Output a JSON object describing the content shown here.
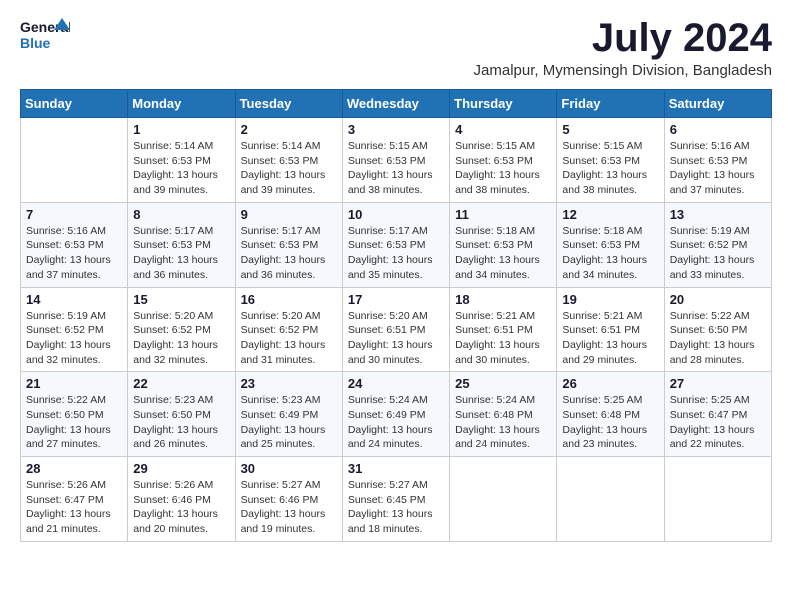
{
  "logo": {
    "line1": "General",
    "line2": "Blue"
  },
  "title": "July 2024",
  "subtitle": "Jamalpur, Mymensingh Division, Bangladesh",
  "header_color": "#2171b5",
  "days_of_week": [
    "Sunday",
    "Monday",
    "Tuesday",
    "Wednesday",
    "Thursday",
    "Friday",
    "Saturday"
  ],
  "weeks": [
    [
      {
        "num": "",
        "info": ""
      },
      {
        "num": "1",
        "info": "Sunrise: 5:14 AM\nSunset: 6:53 PM\nDaylight: 13 hours\nand 39 minutes."
      },
      {
        "num": "2",
        "info": "Sunrise: 5:14 AM\nSunset: 6:53 PM\nDaylight: 13 hours\nand 39 minutes."
      },
      {
        "num": "3",
        "info": "Sunrise: 5:15 AM\nSunset: 6:53 PM\nDaylight: 13 hours\nand 38 minutes."
      },
      {
        "num": "4",
        "info": "Sunrise: 5:15 AM\nSunset: 6:53 PM\nDaylight: 13 hours\nand 38 minutes."
      },
      {
        "num": "5",
        "info": "Sunrise: 5:15 AM\nSunset: 6:53 PM\nDaylight: 13 hours\nand 38 minutes."
      },
      {
        "num": "6",
        "info": "Sunrise: 5:16 AM\nSunset: 6:53 PM\nDaylight: 13 hours\nand 37 minutes."
      }
    ],
    [
      {
        "num": "7",
        "info": "Sunrise: 5:16 AM\nSunset: 6:53 PM\nDaylight: 13 hours\nand 37 minutes."
      },
      {
        "num": "8",
        "info": "Sunrise: 5:17 AM\nSunset: 6:53 PM\nDaylight: 13 hours\nand 36 minutes."
      },
      {
        "num": "9",
        "info": "Sunrise: 5:17 AM\nSunset: 6:53 PM\nDaylight: 13 hours\nand 36 minutes."
      },
      {
        "num": "10",
        "info": "Sunrise: 5:17 AM\nSunset: 6:53 PM\nDaylight: 13 hours\nand 35 minutes."
      },
      {
        "num": "11",
        "info": "Sunrise: 5:18 AM\nSunset: 6:53 PM\nDaylight: 13 hours\nand 34 minutes."
      },
      {
        "num": "12",
        "info": "Sunrise: 5:18 AM\nSunset: 6:53 PM\nDaylight: 13 hours\nand 34 minutes."
      },
      {
        "num": "13",
        "info": "Sunrise: 5:19 AM\nSunset: 6:52 PM\nDaylight: 13 hours\nand 33 minutes."
      }
    ],
    [
      {
        "num": "14",
        "info": "Sunrise: 5:19 AM\nSunset: 6:52 PM\nDaylight: 13 hours\nand 32 minutes."
      },
      {
        "num": "15",
        "info": "Sunrise: 5:20 AM\nSunset: 6:52 PM\nDaylight: 13 hours\nand 32 minutes."
      },
      {
        "num": "16",
        "info": "Sunrise: 5:20 AM\nSunset: 6:52 PM\nDaylight: 13 hours\nand 31 minutes."
      },
      {
        "num": "17",
        "info": "Sunrise: 5:20 AM\nSunset: 6:51 PM\nDaylight: 13 hours\nand 30 minutes."
      },
      {
        "num": "18",
        "info": "Sunrise: 5:21 AM\nSunset: 6:51 PM\nDaylight: 13 hours\nand 30 minutes."
      },
      {
        "num": "19",
        "info": "Sunrise: 5:21 AM\nSunset: 6:51 PM\nDaylight: 13 hours\nand 29 minutes."
      },
      {
        "num": "20",
        "info": "Sunrise: 5:22 AM\nSunset: 6:50 PM\nDaylight: 13 hours\nand 28 minutes."
      }
    ],
    [
      {
        "num": "21",
        "info": "Sunrise: 5:22 AM\nSunset: 6:50 PM\nDaylight: 13 hours\nand 27 minutes."
      },
      {
        "num": "22",
        "info": "Sunrise: 5:23 AM\nSunset: 6:50 PM\nDaylight: 13 hours\nand 26 minutes."
      },
      {
        "num": "23",
        "info": "Sunrise: 5:23 AM\nSunset: 6:49 PM\nDaylight: 13 hours\nand 25 minutes."
      },
      {
        "num": "24",
        "info": "Sunrise: 5:24 AM\nSunset: 6:49 PM\nDaylight: 13 hours\nand 24 minutes."
      },
      {
        "num": "25",
        "info": "Sunrise: 5:24 AM\nSunset: 6:48 PM\nDaylight: 13 hours\nand 24 minutes."
      },
      {
        "num": "26",
        "info": "Sunrise: 5:25 AM\nSunset: 6:48 PM\nDaylight: 13 hours\nand 23 minutes."
      },
      {
        "num": "27",
        "info": "Sunrise: 5:25 AM\nSunset: 6:47 PM\nDaylight: 13 hours\nand 22 minutes."
      }
    ],
    [
      {
        "num": "28",
        "info": "Sunrise: 5:26 AM\nSunset: 6:47 PM\nDaylight: 13 hours\nand 21 minutes."
      },
      {
        "num": "29",
        "info": "Sunrise: 5:26 AM\nSunset: 6:46 PM\nDaylight: 13 hours\nand 20 minutes."
      },
      {
        "num": "30",
        "info": "Sunrise: 5:27 AM\nSunset: 6:46 PM\nDaylight: 13 hours\nand 19 minutes."
      },
      {
        "num": "31",
        "info": "Sunrise: 5:27 AM\nSunset: 6:45 PM\nDaylight: 13 hours\nand 18 minutes."
      },
      {
        "num": "",
        "info": ""
      },
      {
        "num": "",
        "info": ""
      },
      {
        "num": "",
        "info": ""
      }
    ]
  ]
}
